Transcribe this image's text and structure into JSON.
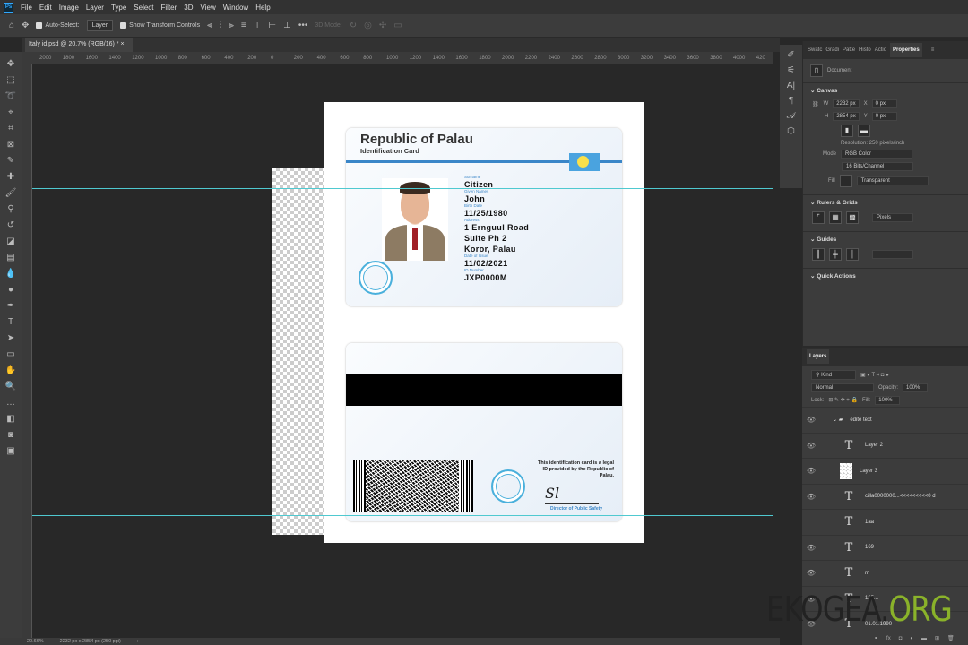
{
  "menu": [
    "File",
    "Edit",
    "Image",
    "Layer",
    "Type",
    "Select",
    "Filter",
    "3D",
    "View",
    "Window",
    "Help"
  ],
  "options": {
    "auto_select": "Auto-Select:",
    "auto_select_value": "Layer",
    "show_transform": "Show Transform Controls",
    "mode_3d": "3D Mode:"
  },
  "document_tab": "Italy id.psd @ 20.7% (RGB/16) *",
  "ruler_ticks": [
    "2000",
    "1800",
    "1600",
    "1400",
    "1200",
    "1000",
    "800",
    "600",
    "400",
    "200",
    "0",
    "200",
    "400",
    "600",
    "800",
    "1000",
    "1200",
    "1400",
    "1600",
    "1800",
    "2000",
    "2200",
    "2400",
    "2600",
    "2800",
    "3000",
    "3200",
    "3400",
    "3600",
    "3800",
    "4000",
    "420"
  ],
  "card_front": {
    "title": "Republic of Palau",
    "subtitle": "Identification Card",
    "fields": [
      {
        "label": "Surname",
        "value": "Citizen"
      },
      {
        "label": "Given Names",
        "value": "John"
      },
      {
        "label": "Birth Date",
        "value": "11/25/1980"
      },
      {
        "label": "Address",
        "value": "1 Ernguul Road"
      },
      {
        "label": "",
        "value": "Suite Ph 2"
      },
      {
        "label": "",
        "value": "Koror, Palau"
      },
      {
        "label": "Date of Issue",
        "value": "11/02/2021"
      },
      {
        "label": "ID Number",
        "value": "JXP0000M"
      }
    ]
  },
  "card_back": {
    "legal": "This identification card is a legal ID provided by the Republic of Palau.",
    "signature": "Sl",
    "director": "Director of Public Safety"
  },
  "panel_tabs": [
    "Swatc",
    "Gradi",
    "Patte",
    "Histo",
    "Actio",
    "Properties"
  ],
  "properties": {
    "document": "Document",
    "canvas": "Canvas",
    "w_label": "W",
    "w": "2232 px",
    "h_label": "H",
    "h": "2854 px",
    "x_label": "X",
    "x": "0 px",
    "y_label": "Y",
    "y": "0 px",
    "resolution": "Resolution: 250 pixels/inch",
    "mode_label": "Mode",
    "mode": "RGB Color",
    "depth": "16 Bits/Channel",
    "fill_label": "Fill",
    "fill": "Transparent",
    "rulers": "Rulers & Grids",
    "units": "Pixels",
    "guides": "Guides",
    "quick": "Quick Actions"
  },
  "layers": {
    "title": "Layers",
    "kind": "Kind",
    "blend": "Normal",
    "opacity_label": "Opacity:",
    "opacity": "100%",
    "lock_label": "Lock:",
    "fill_label": "Fill:",
    "fill": "100%",
    "items": [
      {
        "name": "edite text",
        "type": "group"
      },
      {
        "name": "Layer 2",
        "type": "text"
      },
      {
        "name": "Layer 3",
        "type": "image"
      },
      {
        "name": "cilla0000000...<<<<<<<<<0 d",
        "type": "text"
      },
      {
        "name": "1aa",
        "type": "text"
      },
      {
        "name": "169",
        "type": "text"
      },
      {
        "name": "m",
        "type": "text"
      },
      {
        "name": "125...",
        "type": "text"
      },
      {
        "name": "01.01.1990",
        "type": "text"
      }
    ]
  },
  "status": {
    "zoom": "20.66%",
    "size": "2232 px x 2854 px (250 ppi)"
  },
  "watermark": {
    "a": "EKOGEA.",
    "b": "ORG"
  },
  "colors": {
    "guide": "#4fc9d0",
    "accent": "#3a86c8",
    "flag_blue": "#4aa3df",
    "flag_yellow": "#f9e04b"
  }
}
